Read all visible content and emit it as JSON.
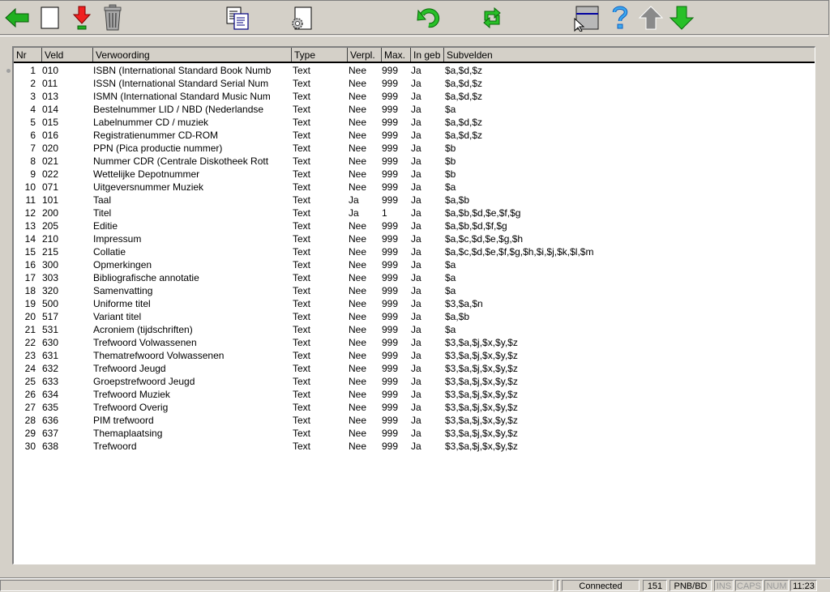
{
  "toolbar": {
    "buttons": [
      {
        "name": "back",
        "icon": "back-arrow-icon",
        "tooltip": "Terug"
      },
      {
        "name": "new",
        "icon": "new-document-icon",
        "tooltip": "Nieuw"
      },
      {
        "name": "download",
        "icon": "download-arrow-icon",
        "tooltip": "Opslaan"
      },
      {
        "name": "delete",
        "icon": "trash-icon",
        "tooltip": "Verwijderen"
      },
      {
        "name": "copy",
        "icon": "copy-documents-icon",
        "tooltip": "Kopiëren"
      },
      {
        "name": "settings",
        "icon": "document-settings-icon",
        "tooltip": "Instellingen"
      },
      {
        "name": "undo",
        "icon": "undo-icon",
        "tooltip": "Ongedaan maken"
      },
      {
        "name": "refresh",
        "icon": "refresh-icon",
        "tooltip": "Vernieuwen"
      },
      {
        "name": "select-window",
        "icon": "window-cursor-icon",
        "tooltip": "Selecteren"
      },
      {
        "name": "help",
        "icon": "help-icon",
        "tooltip": "Help"
      },
      {
        "name": "move-up",
        "icon": "arrow-up-icon",
        "tooltip": "Omhoog",
        "disabled": true
      },
      {
        "name": "move-down",
        "icon": "arrow-down-icon",
        "tooltip": "Omlaag"
      }
    ]
  },
  "table": {
    "columns": [
      "Nr",
      "Veld",
      "Verwoording",
      "Type",
      "Verpl.",
      "Max.",
      "In geb",
      "Subvelden"
    ],
    "rows": [
      [
        "1",
        "010",
        "ISBN (International Standard Book Numb",
        "Text",
        "Nee",
        "999",
        "Ja",
        "$a,$d,$z"
      ],
      [
        "2",
        "011",
        "ISSN (International Standard Serial Num",
        "Text",
        "Nee",
        "999",
        "Ja",
        "$a,$d,$z"
      ],
      [
        "3",
        "013",
        "ISMN (International Standard Music Num",
        "Text",
        "Nee",
        "999",
        "Ja",
        "$a,$d,$z"
      ],
      [
        "4",
        "014",
        "Bestelnummer LID / NBD (Nederlandse",
        "Text",
        "Nee",
        "999",
        "Ja",
        "$a"
      ],
      [
        "5",
        "015",
        "Labelnummer CD / muziek",
        "Text",
        "Nee",
        "999",
        "Ja",
        "$a,$d,$z"
      ],
      [
        "6",
        "016",
        "Registratienummer CD-ROM",
        "Text",
        "Nee",
        "999",
        "Ja",
        "$a,$d,$z"
      ],
      [
        "7",
        "020",
        "PPN (Pica productie nummer)",
        "Text",
        "Nee",
        "999",
        "Ja",
        "$b"
      ],
      [
        "8",
        "021",
        "Nummer CDR (Centrale Diskotheek Rott",
        "Text",
        "Nee",
        "999",
        "Ja",
        "$b"
      ],
      [
        "9",
        "022",
        "Wettelijke Depotnummer",
        "Text",
        "Nee",
        "999",
        "Ja",
        "$b"
      ],
      [
        "10",
        "071",
        "Uitgeversnummer Muziek",
        "Text",
        "Nee",
        "999",
        "Ja",
        "$a"
      ],
      [
        "11",
        "101",
        "Taal",
        "Text",
        "Ja",
        "999",
        "Ja",
        "$a,$b"
      ],
      [
        "12",
        "200",
        "Titel",
        "Text",
        "Ja",
        "1",
        "Ja",
        "$a,$b,$d,$e,$f,$g"
      ],
      [
        "13",
        "205",
        "Editie",
        "Text",
        "Nee",
        "999",
        "Ja",
        "$a,$b,$d,$f,$g"
      ],
      [
        "14",
        "210",
        "Impressum",
        "Text",
        "Nee",
        "999",
        "Ja",
        "$a,$c,$d,$e,$g,$h"
      ],
      [
        "15",
        "215",
        "Collatie",
        "Text",
        "Nee",
        "999",
        "Ja",
        "$a,$c,$d,$e,$f,$g,$h,$i,$j,$k,$l,$m"
      ],
      [
        "16",
        "300",
        "Opmerkingen",
        "Text",
        "Nee",
        "999",
        "Ja",
        "$a"
      ],
      [
        "17",
        "303",
        "Bibliografische annotatie",
        "Text",
        "Nee",
        "999",
        "Ja",
        "$a"
      ],
      [
        "18",
        "320",
        "Samenvatting",
        "Text",
        "Nee",
        "999",
        "Ja",
        "$a"
      ],
      [
        "19",
        "500",
        "Uniforme titel",
        "Text",
        "Nee",
        "999",
        "Ja",
        "$3,$a,$n"
      ],
      [
        "20",
        "517",
        "Variant titel",
        "Text",
        "Nee",
        "999",
        "Ja",
        "$a,$b"
      ],
      [
        "21",
        "531",
        "Acroniem (tijdschriften)",
        "Text",
        "Nee",
        "999",
        "Ja",
        "$a"
      ],
      [
        "22",
        "630",
        "Trefwoord Volwassenen",
        "Text",
        "Nee",
        "999",
        "Ja",
        "$3,$a,$j,$x,$y,$z"
      ],
      [
        "23",
        "631",
        "Thematrefwoord Volwassenen",
        "Text",
        "Nee",
        "999",
        "Ja",
        "$3,$a,$j,$x,$y,$z"
      ],
      [
        "24",
        "632",
        "Trefwoord Jeugd",
        "Text",
        "Nee",
        "999",
        "Ja",
        "$3,$a,$j,$x,$y,$z"
      ],
      [
        "25",
        "633",
        "Groepstrefwoord Jeugd",
        "Text",
        "Nee",
        "999",
        "Ja",
        "$3,$a,$j,$x,$y,$z"
      ],
      [
        "26",
        "634",
        "Trefwoord Muziek",
        "Text",
        "Nee",
        "999",
        "Ja",
        "$3,$a,$j,$x,$y,$z"
      ],
      [
        "27",
        "635",
        "Trefwoord Overig",
        "Text",
        "Nee",
        "999",
        "Ja",
        "$3,$a,$j,$x,$y,$z"
      ],
      [
        "28",
        "636",
        "PIM trefwoord",
        "Text",
        "Nee",
        "999",
        "Ja",
        "$3,$a,$j,$x,$y,$z"
      ],
      [
        "29",
        "637",
        "Themaplaatsing",
        "Text",
        "Nee",
        "999",
        "Ja",
        "$3,$a,$j,$x,$y,$z"
      ],
      [
        "30",
        "638",
        "Trefwoord",
        "Text",
        "Nee",
        "999",
        "Ja",
        "$3,$a,$j,$x,$y,$z"
      ]
    ]
  },
  "statusbar": {
    "message": "",
    "connection": "Connected",
    "count": "151",
    "database": "PNB/BD",
    "ins": "INS",
    "caps": "CAPS",
    "num": "NUM",
    "time": "11:23"
  }
}
